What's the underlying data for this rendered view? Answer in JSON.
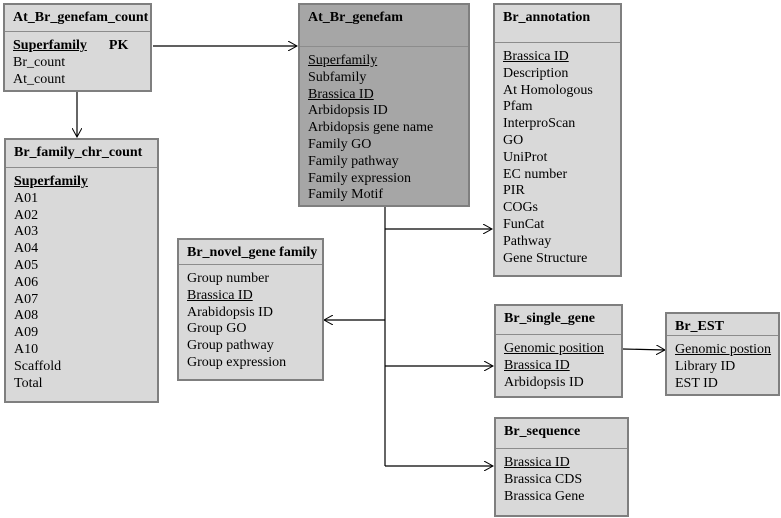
{
  "entities": [
    {
      "id": "at-br-genefam-count",
      "title": "At_Br_genefam_count",
      "fields": [
        {
          "name": "Superfamily",
          "underline": true,
          "bold": true,
          "tag": "PK"
        },
        {
          "name": "Br_count"
        },
        {
          "name": "At_count"
        }
      ]
    },
    {
      "id": "br-family-chr-count",
      "title": "Br_family_chr_count",
      "fields": [
        {
          "name": "Superfamily",
          "underline": true,
          "bold": true
        },
        {
          "name": "A01"
        },
        {
          "name": "A02"
        },
        {
          "name": "A03"
        },
        {
          "name": "A04"
        },
        {
          "name": "A05"
        },
        {
          "name": "A06"
        },
        {
          "name": "A07"
        },
        {
          "name": "A08"
        },
        {
          "name": "A09"
        },
        {
          "name": "A10"
        },
        {
          "name": "Scaffold"
        },
        {
          "name": "Total"
        }
      ]
    },
    {
      "id": "at-br-genefam",
      "title": "At_Br_genefam",
      "shade": "#a6a6a6",
      "fields": [
        {
          "name": "Superfamily",
          "underline": true
        },
        {
          "name": "Subfamily"
        },
        {
          "name": "Brassica ID",
          "underline": true
        },
        {
          "name": "Arbidopsis ID"
        },
        {
          "name": "Arbidopsis gene name"
        },
        {
          "name": "Family GO"
        },
        {
          "name": "Family pathway"
        },
        {
          "name": "Family expression"
        },
        {
          "name": "Family Motif"
        }
      ]
    },
    {
      "id": "br-annotation",
      "title": "Br_annotation",
      "fields": [
        {
          "name": "Brassica ID",
          "underline": true
        },
        {
          "name": "Description"
        },
        {
          "name": "At Homologous"
        },
        {
          "name": "Pfam"
        },
        {
          "name": "InterproScan"
        },
        {
          "name": "GO"
        },
        {
          "name": "UniProt"
        },
        {
          "name": "EC number"
        },
        {
          "name": "PIR"
        },
        {
          "name": "COGs"
        },
        {
          "name": "FunCat"
        },
        {
          "name": "Pathway"
        },
        {
          "name": "Gene Structure"
        }
      ]
    },
    {
      "id": "br-novel-gene-family",
      "title": "Br_novel_gene family",
      "fields": [
        {
          "name": "Group number"
        },
        {
          "name": "Brassica ID",
          "underline": true
        },
        {
          "name": "Arabidopsis ID"
        },
        {
          "name": "Group GO"
        },
        {
          "name": "Group pathway"
        },
        {
          "name": "Group expression"
        }
      ]
    },
    {
      "id": "br-single-gene",
      "title": "Br_single_gene",
      "fields": [
        {
          "name": "Genomic position",
          "underline": true
        },
        {
          "name": "Brassica ID",
          "underline": true
        },
        {
          "name": "Arbidopsis ID"
        }
      ]
    },
    {
      "id": "br-est",
      "title": "Br_EST",
      "fields": [
        {
          "name": "Genomic postion",
          "underline": true
        },
        {
          "name": "Library ID"
        },
        {
          "name": "EST ID"
        }
      ]
    },
    {
      "id": "br-sequence",
      "title": "Br_sequence",
      "fields": [
        {
          "name": "Brassica ID",
          "underline": true
        },
        {
          "name": "Brassica CDS"
        },
        {
          "name": "Brassica Gene"
        }
      ]
    }
  ],
  "relations": [
    {
      "from": "At_Br_genefam_count",
      "to": "At_Br_genefam"
    },
    {
      "from": "At_Br_genefam_count",
      "to": "Br_family_chr_count"
    },
    {
      "from": "At_Br_genefam",
      "to": "Br_annotation"
    },
    {
      "from": "At_Br_genefam",
      "to": "Br_novel_gene family"
    },
    {
      "from": "At_Br_genefam",
      "to": "Br_single_gene"
    },
    {
      "from": "At_Br_genefam",
      "to": "Br_sequence"
    },
    {
      "from": "Br_single_gene",
      "to": "Br_EST"
    }
  ],
  "colors": {
    "box": "#d9d9d9",
    "box_dark": "#a6a6a6",
    "border": "#7f7f7f"
  }
}
